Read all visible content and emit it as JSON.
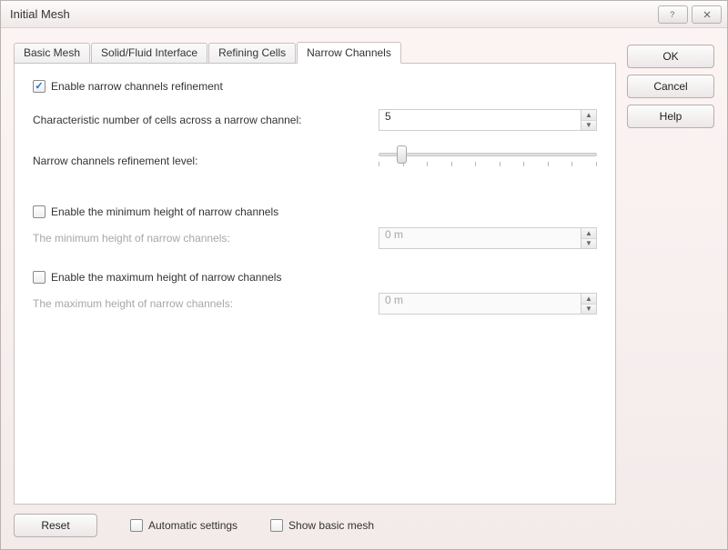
{
  "window": {
    "title": "Initial Mesh"
  },
  "titlebar": {
    "help_icon": "help-icon",
    "close_icon": "close-icon"
  },
  "tabs": [
    {
      "label": "Basic Mesh",
      "active": false
    },
    {
      "label": "Solid/Fluid Interface",
      "active": false
    },
    {
      "label": "Refining Cells",
      "active": false
    },
    {
      "label": "Narrow Channels",
      "active": true
    }
  ],
  "panel": {
    "enable_nc": {
      "checked": true,
      "label": "Enable narrow channels refinement"
    },
    "cells_across": {
      "label": "Characteristic number of cells across a narrow channel:",
      "value": "5"
    },
    "refine_level": {
      "label": "Narrow channels refinement level:",
      "value": 1,
      "max": 9
    },
    "enable_min_h": {
      "checked": false,
      "label": "Enable the minimum height of narrow channels"
    },
    "min_h": {
      "label": "The minimum height of narrow channels:",
      "value": "0 m",
      "disabled": true
    },
    "enable_max_h": {
      "checked": false,
      "label": "Enable the maximum height of narrow channels"
    },
    "max_h": {
      "label": "The maximum height of narrow channels:",
      "value": "0 m",
      "disabled": true
    }
  },
  "buttons": {
    "ok": "OK",
    "cancel": "Cancel",
    "help": "Help",
    "reset": "Reset"
  },
  "bottom": {
    "auto_settings": {
      "checked": false,
      "label": "Automatic settings"
    },
    "show_basic": {
      "checked": false,
      "label": "Show basic mesh"
    }
  }
}
